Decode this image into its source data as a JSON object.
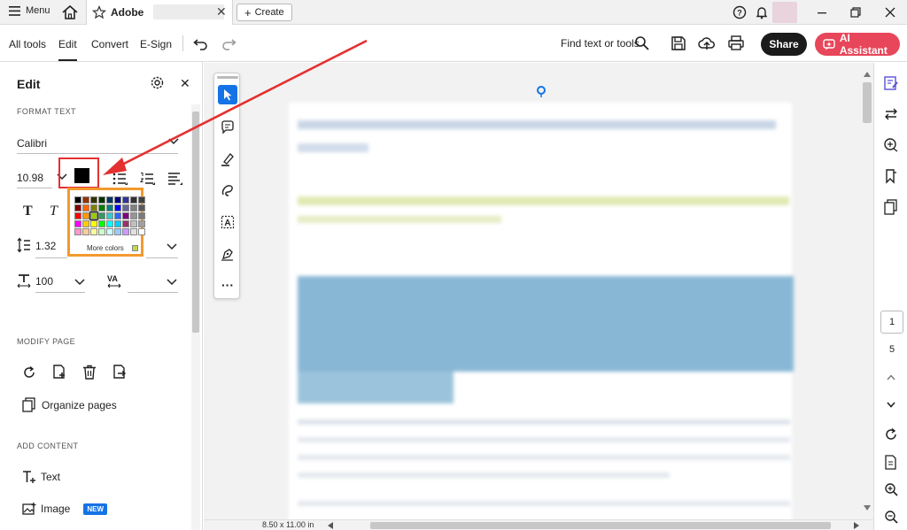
{
  "titlebar": {
    "menu_label": "Menu",
    "tab_title": "Adobe",
    "create_label": "Create"
  },
  "toolbar": {
    "nav": [
      "All tools",
      "Edit",
      "Convert",
      "E-Sign"
    ],
    "active_nav": "Edit",
    "find_label": "Find text or tools",
    "share_label": "Share",
    "ai_label": "AI Assistant"
  },
  "panel": {
    "title": "Edit",
    "format_text_heading": "FORMAT TEXT",
    "font_name": "Calibri",
    "font_size": "10.98",
    "current_color": "#000000",
    "line_spacing": "1.32",
    "char_scale": "100",
    "modify_page_heading": "MODIFY PAGE",
    "organize_pages_label": "Organize pages",
    "add_content_heading": "ADD CONTENT",
    "text_label": "Text",
    "image_label": "Image",
    "new_badge": "NEW"
  },
  "color_picker": {
    "more_colors_label": "More colors",
    "swatches": [
      "#000000",
      "#993300",
      "#333300",
      "#003300",
      "#003366",
      "#000080",
      "#333399",
      "#333333",
      "#404040",
      "#800000",
      "#ff6600",
      "#808000",
      "#008000",
      "#008080",
      "#0000ff",
      "#666699",
      "#808080",
      "#5a5a5a",
      "#ff0000",
      "#ff9900",
      "#99cc00",
      "#339966",
      "#33cccc",
      "#3366ff",
      "#800080",
      "#969696",
      "#7a7a7a",
      "#ff00ff",
      "#ffcc00",
      "#ffff00",
      "#00ff00",
      "#00ffff",
      "#00ccff",
      "#993366",
      "#c0c0c0",
      "#a0a0a0",
      "#ff99cc",
      "#ffcc99",
      "#ffff99",
      "#ccffcc",
      "#ccffff",
      "#99ccff",
      "#cc99ff",
      "#e0e0e0",
      "#ffffff"
    ]
  },
  "status": {
    "page_size": "8.50 x 11.00 in",
    "current_page": "1",
    "total_pages": "5"
  },
  "colors": {
    "accent_blue": "#1473e6",
    "share_bg": "#1b1b1b",
    "ai_bg": "#e8465a",
    "annotation_red": "#e53030",
    "picker_border": "#f29a2e",
    "new_badge_bg": "#1473e6"
  }
}
